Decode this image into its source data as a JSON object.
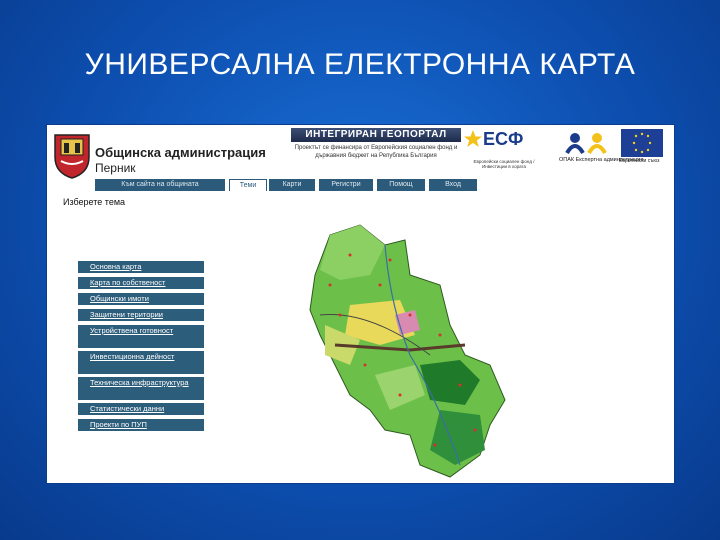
{
  "slide": {
    "title": "УНИВЕРСАЛНА ЕЛЕКТРОННА КАРТА"
  },
  "header": {
    "admin_title": "Общинска администрация",
    "admin_city": "Перник",
    "geo_banner": "ИНТЕГРИРАН ГЕОПОРТАЛ",
    "project_text": "Проектът се финансира от Европейския социален фонд и държавния бюджет на Република България",
    "esf_letters": "ЕСФ",
    "esf_sub": "Европейски социален фонд / Инвестиции в хората",
    "opk_label": "ОПАК Експертна администрация",
    "eu_label": "Европейски съюз"
  },
  "tabs": [
    {
      "label": "Към сайта на общината",
      "active": false
    },
    {
      "label": "Теми",
      "active": true
    },
    {
      "label": "Карти",
      "active": false
    },
    {
      "label": "Регистри",
      "active": false
    },
    {
      "label": "Помощ",
      "active": false
    },
    {
      "label": "Вход",
      "active": false
    }
  ],
  "theme_section": {
    "label": "Изберете тема",
    "items": [
      "Основна карта",
      "Карта по собственост",
      "Общински имоти",
      "Защитени територии",
      "Устройствена готовност",
      "Инвестиционна дейност",
      "Техническа инфраструктура",
      "Статистически данни",
      "Проекти по ПУП"
    ]
  },
  "colors": {
    "background": "#0d4fb0",
    "menu": "#2c5d7b",
    "tab": "#2b5a7a",
    "map_green": "#6cc04a",
    "map_dark_green": "#1f7a2a",
    "map_yellow": "#e8d95a",
    "map_pink": "#d98ab0",
    "crest_red": "#c0262c"
  },
  "icons": {
    "crest": "municipal-crest-icon",
    "eu_flag": "eu-flag-icon",
    "esf": "esf-logo-icon"
  }
}
